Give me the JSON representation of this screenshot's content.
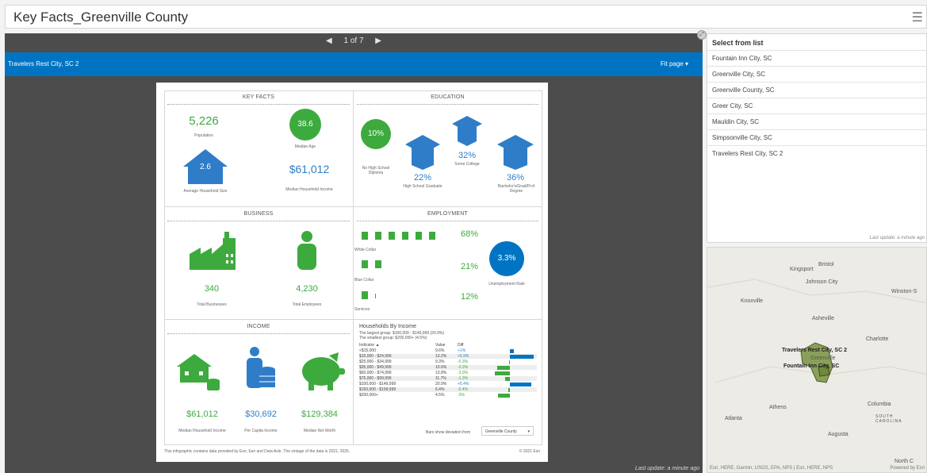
{
  "app": {
    "title": "Key Facts_Greenville County"
  },
  "pager": {
    "prev": "◀",
    "label": "1 of 7",
    "next": "▶"
  },
  "header": {
    "location": "Travelers Rest City, SC 2",
    "fit": "Fit page ▾"
  },
  "footer_update": "Last update: a minute ago",
  "infographic": {
    "key_facts": {
      "title": "KEY FACTS",
      "population_value": "5,226",
      "population_label": "Population",
      "median_age_value": "38.6",
      "median_age_label": "Median Age",
      "hh_size_value": "2.6",
      "hh_size_label": "Average Household Size",
      "income_value": "$61,012",
      "income_label": "Median Household Income"
    },
    "education": {
      "title": "EDUCATION",
      "no_hs_value": "10%",
      "no_hs_label": "No High School Diploma",
      "hs_value": "22%",
      "hs_label": "High School Graduate",
      "college_value": "32%",
      "college_label": "Some College",
      "bach_value": "36%",
      "bach_label": "Bachelor's/Grad/Prof Degree"
    },
    "business": {
      "title": "BUSINESS",
      "businesses_value": "340",
      "businesses_label": "Total Businesses",
      "employees_value": "4,230",
      "employees_label": "Total Employees"
    },
    "employment": {
      "title": "EMPLOYMENT",
      "white_value": "68%",
      "white_label": "White Collar",
      "blue_value": "21%",
      "blue_label": "Blue Collar",
      "services_value": "12%",
      "services_label": "Services",
      "unemp_value": "3.3%",
      "unemp_label": "Unemployment Rate"
    },
    "income": {
      "title": "INCOME",
      "median_hh_value": "$61,012",
      "median_hh_label": "Median Household Income",
      "per_capita_value": "$30,692",
      "per_capita_label": "Per Capita Income",
      "net_worth_value": "$129,384",
      "net_worth_label": "Median Net Worth"
    },
    "households": {
      "title": "Households By Income",
      "largest": "The largest group: $100,000 - $149,999 (20.9%)",
      "smallest": "The smallest group: $200,000+ (4.5%)",
      "col_indicator": "Indicator ▲",
      "col_value": "Value",
      "col_diff": "Diff",
      "rows": [
        {
          "indicator": "<$15,000",
          "value": "9.6%",
          "diff": "+1%",
          "diff_num": 1
        },
        {
          "indicator": "$15,000 - $24,999",
          "value": "13.2%",
          "diff": "+5.9%",
          "diff_num": 5.9
        },
        {
          "indicator": "$25,000 - $34,999",
          "value": "9.3%",
          "diff": "-0.3%",
          "diff_num": -0.3
        },
        {
          "indicator": "$35,000 - $49,999",
          "value": "10.6%",
          "diff": "-3.3%",
          "diff_num": -3.3
        },
        {
          "indicator": "$50,000 - $74,999",
          "value": "13.8%",
          "diff": "-3.9%",
          "diff_num": -3.9
        },
        {
          "indicator": "$75,000 - $99,999",
          "value": "11.7%",
          "diff": "-1.3%",
          "diff_num": -1.3
        },
        {
          "indicator": "$100,000 - $149,999",
          "value": "20.9%",
          "diff": "+5.4%",
          "diff_num": 5.4
        },
        {
          "indicator": "$150,000 - $199,999",
          "value": "6.4%",
          "diff": "-0.4%",
          "diff_num": -0.4
        },
        {
          "indicator": "$200,000+",
          "value": "4.5%",
          "diff": "-3%",
          "diff_num": -3
        }
      ],
      "bars_from_label": "Bars show deviation from",
      "bars_from_value": "Greenville County"
    },
    "footer": "This infographic contains data provided by Esri, Esri and Data Axle. The vintage of the data is 2021, 2026.",
    "copyright": "© 2021 Esri"
  },
  "list": {
    "header": "Select from list",
    "items": [
      "Fountain Inn City, SC",
      "Greenville City, SC",
      "Greenville County, SC",
      "Greer City, SC",
      "Mauldin City, SC",
      "Simpsonville City, SC",
      "Travelers Rest City, SC 2"
    ],
    "update": "Last update: a minute ago"
  },
  "map": {
    "cities": [
      "Bristol",
      "Kingsport",
      "Johnson City",
      "Knoxville",
      "Winston-S",
      "Asheville",
      "Charlotte",
      "Travelers Rest City, SC 2",
      "Greenville",
      "Fountain Inn City, SC",
      "Athens",
      "Columbia",
      "Atlanta",
      "SOUTH CAROLINA",
      "Augusta",
      "North C"
    ],
    "attribution": "Esri, HERE, Garmin, USGS, EPA, NPS | Esri, HERE, NPS",
    "powered": "Powered by Esri"
  },
  "colors": {
    "green": "#3daa3d",
    "blue": "#2f7dc8",
    "bar_blue": "#0074c2"
  }
}
